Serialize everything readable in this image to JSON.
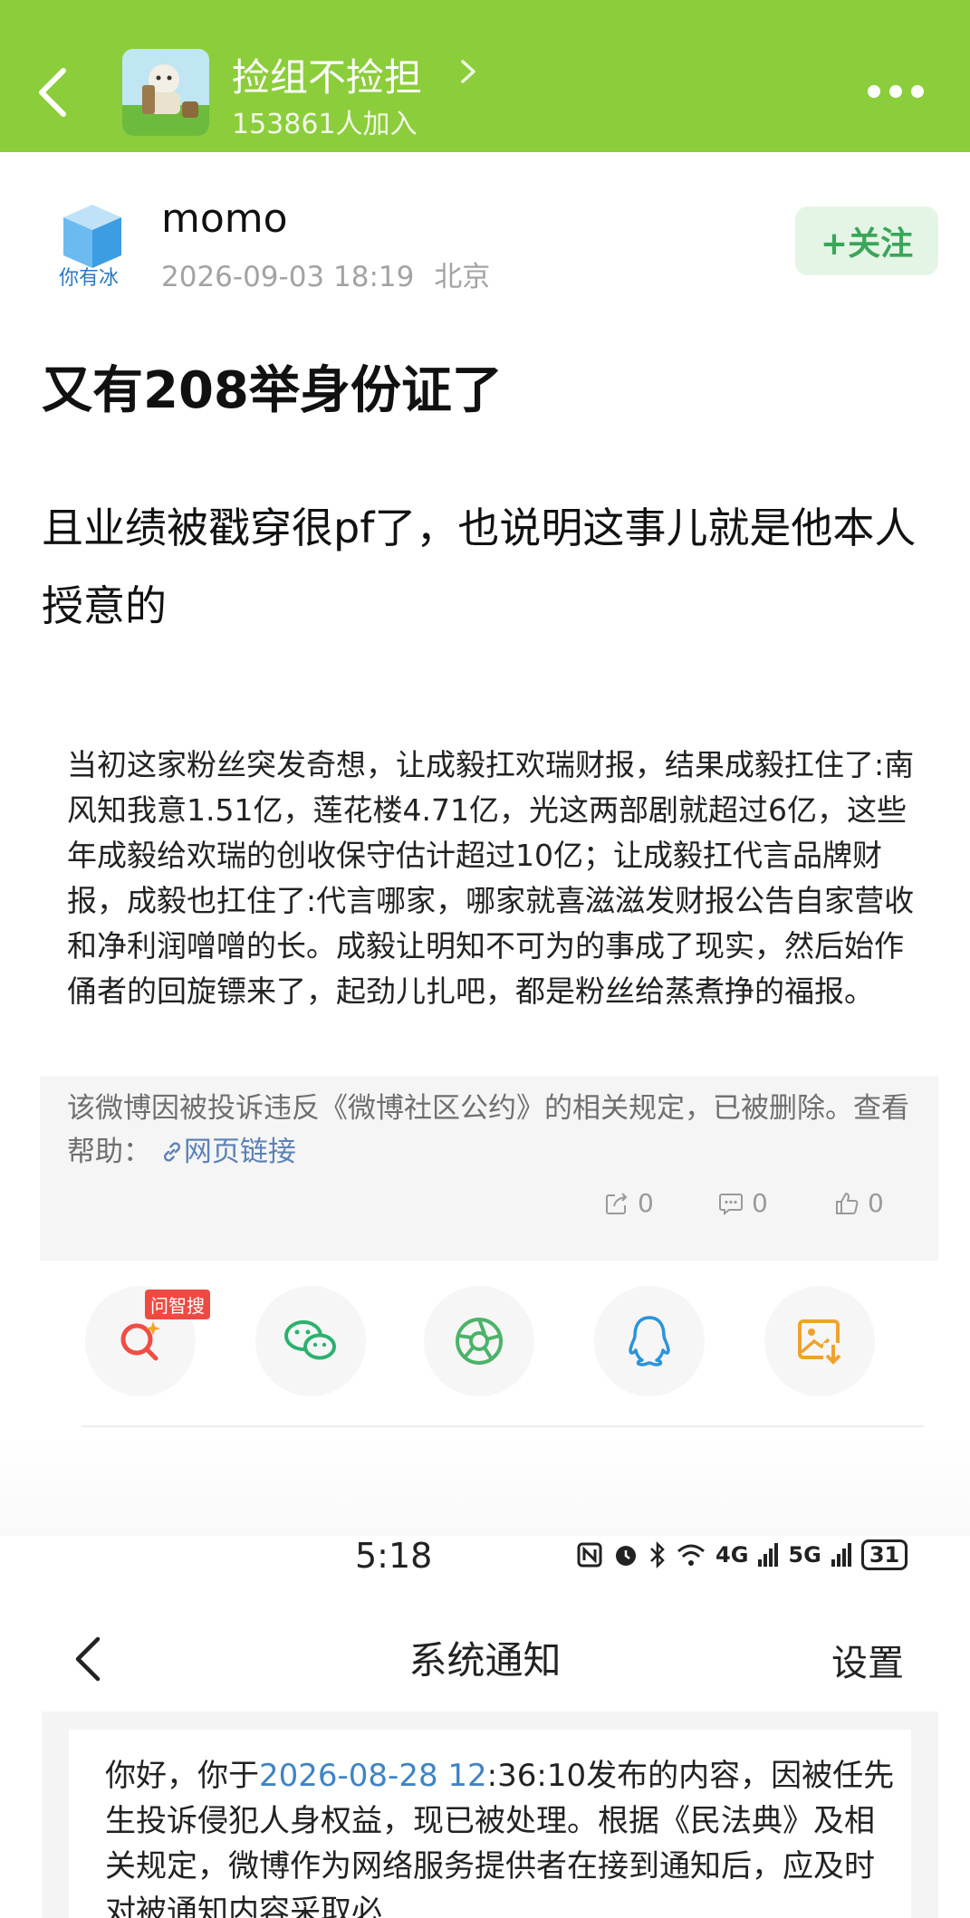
{
  "header": {
    "group_name": "捡组不捡担",
    "members": "153861人加入",
    "background_color": "#8ccd3b",
    "icons": [
      "back-icon",
      "chevron-right-icon",
      "more-icon"
    ]
  },
  "post": {
    "author": "momo",
    "avatar_text": "你有冰",
    "time": "2026-09-03 18:19",
    "location": "北京",
    "follow_label": "+关注",
    "title": "又有208举身份证了",
    "body": "且业绩被戳穿很pf了，也说明这事儿就是他本人授意的"
  },
  "quoted": {
    "text": "当初这家粉丝突发奇想，让成毅扛欢瑞财报，结果成毅扛住了:南风知我意1.51亿，莲花楼4.71亿，光这两部剧就超过6亿，这些年成毅给欢瑞的创收保守估计超过10亿；让成毅扛代言品牌财报，成毅也扛住了:代言哪家，哪家就喜滋滋发财报公告自家营收和净利润噌噌的长。成毅让明知不可为的事成了现实，然后始作俑者的回旋镖来了，起劲儿扎吧，都是粉丝给蒸煮挣的福报。",
    "deleted_notice": "该微博因被投诉违反《微博社区公约》的相关规定，已被删除。查看帮助：",
    "link_label": "网页链接",
    "reposts": "0",
    "comments": "0",
    "likes": "0"
  },
  "share": {
    "badge": "问智搜",
    "icons": [
      "search-ai-icon",
      "wechat-icon",
      "moments-icon",
      "qq-icon",
      "save-image-icon"
    ]
  },
  "phone_status": {
    "time": "5:18",
    "battery": "31",
    "net1": "4G",
    "net2": "5G"
  },
  "notification": {
    "title": "系统通知",
    "settings": "设置",
    "text_prefix": "你好，你于",
    "date": "2026-08-28 12",
    "text_rest": ":36:10发布的内容，因被任先生投诉侵犯人身权益，现已被处理。根据《民法典》及相关规定，微博作为网络服务提供者在接到通知后，应及时对被通知内容采取必"
  }
}
